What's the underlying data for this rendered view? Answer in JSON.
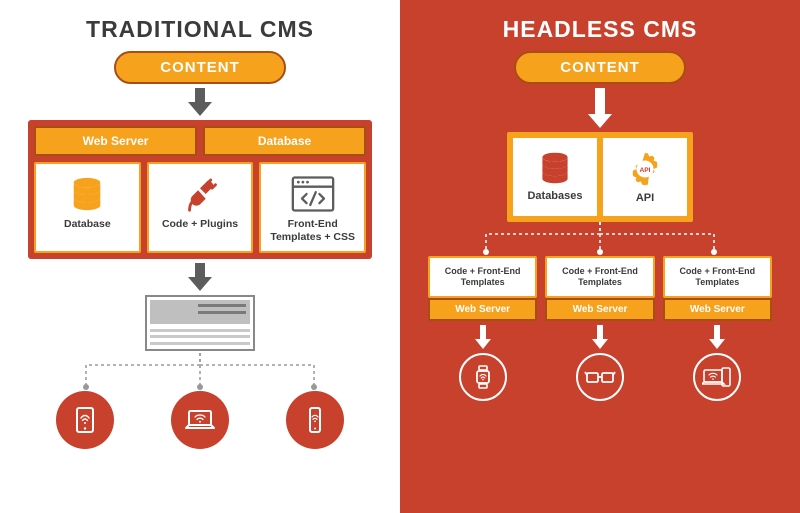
{
  "left": {
    "title": "TRADITIONAL CMS",
    "content_pill": "CONTENT",
    "server_row": {
      "web_server": "Web Server",
      "database": "Database"
    },
    "cards": {
      "database": "Database",
      "code": "Code + Plugins",
      "frontend": "Front-End Templates + CSS"
    },
    "devices": [
      "tablet",
      "laptop",
      "phone"
    ]
  },
  "right": {
    "title": "HEADLESS CMS",
    "content_pill": "CONTENT",
    "cards": {
      "databases": "Databases",
      "api": "API"
    },
    "frontend": {
      "template_label": "Code + Front-End Templates",
      "server_label": "Web Server"
    },
    "devices": [
      "smartwatch",
      "smartglasses",
      "multi-device"
    ]
  }
}
